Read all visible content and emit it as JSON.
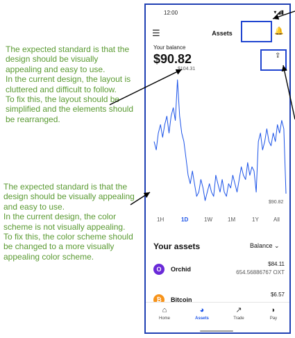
{
  "annotations": [
    "The expected standard is that the design should be visually appealing and easy to use.\nIn the current design, the layout is cluttered and difficult to follow.\nTo fix this, the layout should be simplified and the elements should be rearranged.",
    "The expected standard is that the design should be visually appealing and easy to use.\nIn the current design, the color scheme is not visually appealing.\nTo fix this, the color scheme should be changed to a more visually appealing color scheme."
  ],
  "status": {
    "time": "12:00",
    "icons": "▾◢▮"
  },
  "header": {
    "title": "Assets",
    "menu_icon": "☰",
    "bell_icon": "🔔"
  },
  "balance": {
    "label": "Your balance",
    "value": "$90.82",
    "share_icon": "⇪"
  },
  "chart_data": {
    "type": "line",
    "max_label": "$104.31",
    "min_label": "$90.82",
    "series": [
      {
        "values": [
          97,
          96,
          98,
          99,
          97.5,
          99,
          100,
          98,
          100,
          101,
          99.5,
          104.31,
          100,
          98,
          97,
          95,
          93,
          92,
          93.5,
          92,
          90.5,
          91,
          92.5,
          91.5,
          90,
          91,
          92,
          91,
          90.5,
          93,
          92,
          91,
          92.5,
          91,
          90.5,
          92,
          91.5,
          93,
          92,
          91,
          92.5,
          94,
          93,
          92.5,
          94.5,
          93,
          94,
          93.5,
          91,
          97,
          98,
          96,
          97,
          98.5,
          97,
          96.5,
          98,
          97,
          99,
          98,
          99.5,
          98.5,
          90.82
        ]
      }
    ],
    "accent": "#1a52e8"
  },
  "ranges": [
    "1H",
    "1D",
    "1W",
    "1M",
    "1Y",
    "All"
  ],
  "active_range": "1D",
  "assets": {
    "heading": "Your assets",
    "sort_label": "Balance ⌄",
    "items": [
      {
        "name": "Orchid",
        "value": "$84.11",
        "qty": "654.56886767 OXT",
        "icon": "O",
        "color": "#6a2ad8"
      },
      {
        "name": "Bitcoin",
        "value": "$6.57",
        "qty": "",
        "icon": "₿",
        "color": "#f7931a"
      }
    ]
  },
  "nav": [
    {
      "label": "Home",
      "icon": "⌂"
    },
    {
      "label": "Assets",
      "icon": "◕"
    },
    {
      "label": "Trade",
      "icon": "↗"
    },
    {
      "label": "Pay",
      "icon": "◗"
    }
  ]
}
